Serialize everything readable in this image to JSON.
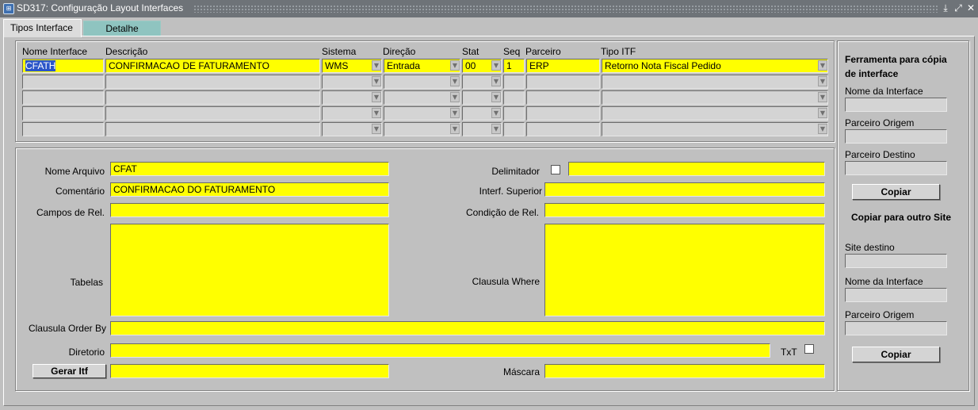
{
  "window": {
    "title": "SD317: Configuração Layout Interfaces",
    "icon": "app-icon"
  },
  "tabs": [
    {
      "label": "Tipos Interface",
      "active": true
    },
    {
      "label": "Detalhe",
      "active": false
    }
  ],
  "grid": {
    "headers": {
      "nome_interface": "Nome Interface",
      "descricao": "Descrição",
      "sistema": "Sistema",
      "direcao": "Direção",
      "stat": "Stat",
      "seq": "Seq",
      "parceiro": "Parceiro",
      "tipo_itf": "Tipo ITF"
    },
    "rows": [
      {
        "nome_interface": "CFATH",
        "descricao": "CONFIRMACAO DE FATURAMENTO",
        "sistema": "WMS",
        "direcao": "Entrada",
        "stat": "00",
        "seq": "1",
        "parceiro": "ERP",
        "tipo_itf": "Retorno Nota Fiscal Pedido"
      },
      {
        "nome_interface": "",
        "descricao": "",
        "sistema": "",
        "direcao": "",
        "stat": "",
        "seq": "",
        "parceiro": "",
        "tipo_itf": ""
      },
      {
        "nome_interface": "",
        "descricao": "",
        "sistema": "",
        "direcao": "",
        "stat": "",
        "seq": "",
        "parceiro": "",
        "tipo_itf": ""
      },
      {
        "nome_interface": "",
        "descricao": "",
        "sistema": "",
        "direcao": "",
        "stat": "",
        "seq": "",
        "parceiro": "",
        "tipo_itf": ""
      },
      {
        "nome_interface": "",
        "descricao": "",
        "sistema": "",
        "direcao": "",
        "stat": "",
        "seq": "",
        "parceiro": "",
        "tipo_itf": ""
      }
    ]
  },
  "detail": {
    "nome_arquivo_label": "Nome Arquivo",
    "nome_arquivo": "CFAT",
    "comentario_label": "Comentário",
    "comentario": "CONFIRMACAO DO FATURAMENTO",
    "campos_rel_label": "Campos de Rel.",
    "campos_rel": "",
    "tabelas_label": "Tabelas",
    "tabelas": "",
    "delimitador_label": "Delimitador",
    "delimitador": "",
    "interf_superior_label": "Interf. Superior",
    "interf_superior": "",
    "condicao_rel_label": "Condição de Rel.",
    "condicao_rel": "",
    "clausula_where_label": "Clausula Where",
    "clausula_where": "",
    "clausula_order_label": "Clausula Order By",
    "clausula_order": "",
    "diretorio_label": "Diretorio",
    "diretorio": "",
    "txt_label": "TxT",
    "gerar_itf_label": "Gerar Itf",
    "gerar_itf_value": "",
    "mascara_label": "Máscara",
    "mascara": ""
  },
  "copy_tool": {
    "title": "Ferramenta para cópia de interface",
    "nome_interface_label": "Nome da Interface",
    "nome_interface": "",
    "parceiro_origem_label": "Parceiro Origem",
    "parceiro_origem": "",
    "parceiro_destino_label": "Parceiro Destino",
    "parceiro_destino": "",
    "copiar_label": "Copiar"
  },
  "copy_site": {
    "title": "Copiar para outro Site",
    "site_destino_label": "Site destino",
    "site_destino": "",
    "nome_interface_label": "Nome da Interface",
    "nome_interface": "",
    "parceiro_origem_label": "Parceiro Origem",
    "parceiro_origem": "",
    "copiar_label": "Copiar"
  },
  "colors": {
    "required_field": "#ffff00",
    "selected_text": "#2a55c8",
    "inactive_tab": "#8fc4c0"
  }
}
